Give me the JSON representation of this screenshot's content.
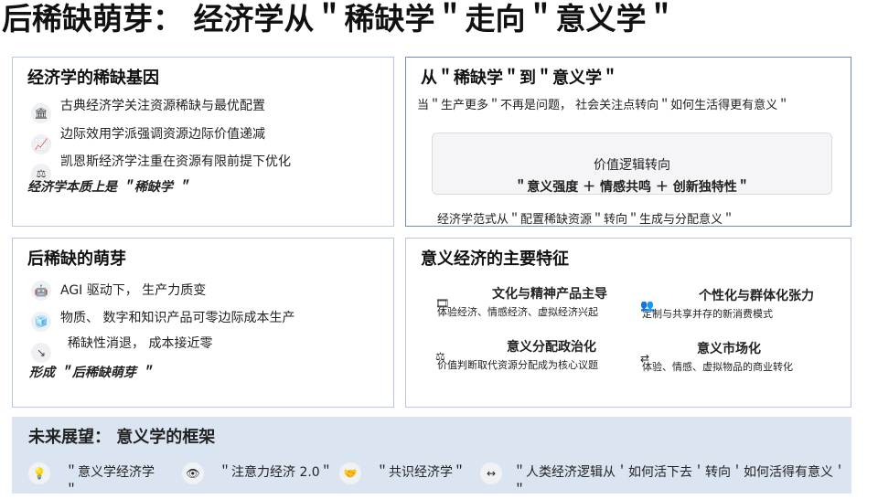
{
  "title": "后稀缺萌芽： 经济学从＂稀缺学＂走向＂意义学＂",
  "card1": {
    "heading": "经济学的稀缺基因",
    "items": [
      {
        "icon": "bank-icon",
        "text": "古典经济学关注资源稀缺与最优配置"
      },
      {
        "icon": "chart-line-icon",
        "text": "边际效用学派强调资源边际价值递减"
      },
      {
        "icon": "balance-scale-icon",
        "text": "凯恩斯经济学注重在资源有限前提下优化"
      }
    ],
    "conclusion": "经济学本质上是 ＂稀缺学 ＂"
  },
  "card2": {
    "heading": "从＂稀缺学＂到＂意义学＂",
    "intro": "当＂生产更多＂不再是问题， 社会关注点转向＂如何生活得更有意义＂",
    "box_title": "价值逻辑转向",
    "box_formula": "＂意义强度 ＋ 情感共鸣 ＋ 创新独特性＂",
    "footer": "经济学范式从＂配置稀缺资源＂转向＂生成与分配意义＂"
  },
  "card3": {
    "heading": "后稀缺的萌芽",
    "items": [
      {
        "icon": "robot-icon",
        "text": "AGI 驱动下， 生产力质变"
      },
      {
        "icon": "cubes-icon",
        "text": "物质、 数字和知识产品可零边际成本生产"
      },
      {
        "icon": "trend-down-icon",
        "text": "稀缺性消退， 成本接近零"
      }
    ],
    "conclusion": "形成 ＂后稀缺萌芽 ＂"
  },
  "card4": {
    "heading": "意义经济的主要特征",
    "features": [
      {
        "icon": "film-icon",
        "title": "文化与精神产品主导",
        "desc": "体验经济、情感经济、虚拟经济兴起"
      },
      {
        "icon": "users-icon",
        "title": "个性化与群体化张力",
        "desc": "定制与共享并存的新消费模式"
      },
      {
        "icon": "gavel-icon",
        "title": "意义分配政治化",
        "desc": "价值判断取代资源分配成为核心议题"
      },
      {
        "icon": "exchange-icon",
        "title": "意义市场化",
        "desc": "体验、情感、虚拟物品的商业转化"
      }
    ]
  },
  "future": {
    "heading": "未来展望： 意义学的框架",
    "items": [
      {
        "icon": "lightbulb-icon",
        "text": "＂意义学经济学＂"
      },
      {
        "icon": "eye-icon",
        "text": "＂注意力经济 2.0＂"
      },
      {
        "icon": "handshake-icon",
        "text": "＂共识经济学＂"
      },
      {
        "icon": "arrows-icon",
        "text": "＂人类经济逻辑从＇如何活下去＇转向＇如何活得有意义＇＂"
      }
    ]
  }
}
